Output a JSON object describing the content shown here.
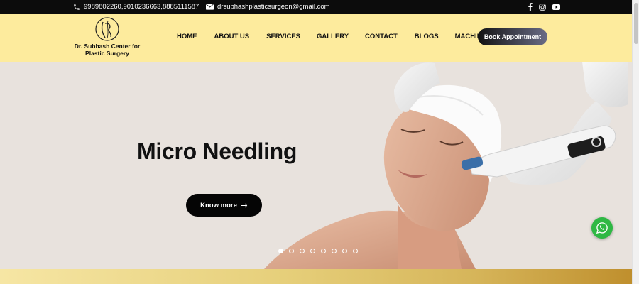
{
  "topbar": {
    "phone": "9989802260,9010236663,8885111587",
    "email": "drsubhashplasticsurgeon@gmail.com",
    "icons": [
      "phone-icon",
      "mail-icon",
      "facebook-icon",
      "instagram-icon",
      "youtube-icon"
    ]
  },
  "header": {
    "logo_name": "Dr. Subhash Center for Plastic Surgery",
    "nav": [
      "HOME",
      "ABOUT US",
      "SERVICES",
      "GALLERY",
      "CONTACT",
      "BLOGS",
      "MACHINERY"
    ],
    "book_label": "Book Appointment"
  },
  "hero": {
    "title": "Micro Needling",
    "button_label": "Know more",
    "slide_count": 8,
    "active_slide": 1
  },
  "colors": {
    "header_bg": "#fdeb9d",
    "topbar_bg": "#0c0c0c",
    "hero_bg": "#e8e2dd",
    "whatsapp": "#2fb844"
  }
}
